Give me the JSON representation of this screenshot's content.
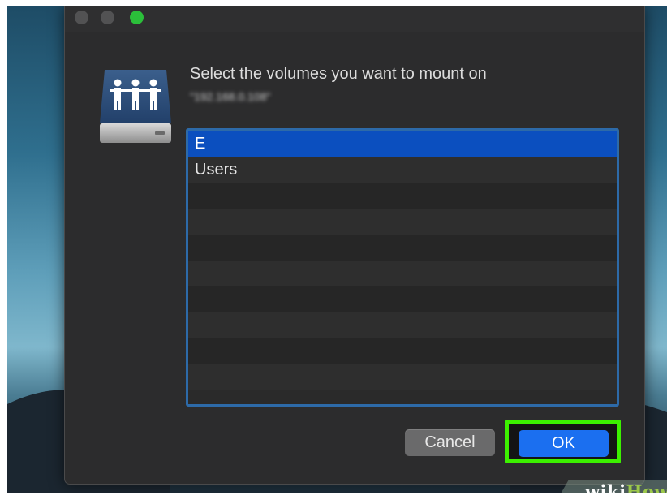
{
  "dialog": {
    "message": "Select the volumes you want to mount on",
    "server_address": "\"192.168.0.108\"",
    "volumes": [
      {
        "label": "E",
        "selected": true
      },
      {
        "label": "Users",
        "selected": false
      },
      {
        "label": "",
        "selected": false
      },
      {
        "label": "",
        "selected": false
      },
      {
        "label": "",
        "selected": false
      },
      {
        "label": "",
        "selected": false
      },
      {
        "label": "",
        "selected": false
      },
      {
        "label": "",
        "selected": false
      },
      {
        "label": "",
        "selected": false
      },
      {
        "label": "",
        "selected": false
      }
    ],
    "cancel_label": "Cancel",
    "ok_label": "OK"
  },
  "watermark": {
    "wiki": "wiki",
    "how": "How"
  },
  "colors": {
    "accent_blue": "#1b6ff0",
    "selection_blue": "#0b4fbf",
    "highlight_green": "#3cf000",
    "traffic_green": "#2bbf3a"
  }
}
